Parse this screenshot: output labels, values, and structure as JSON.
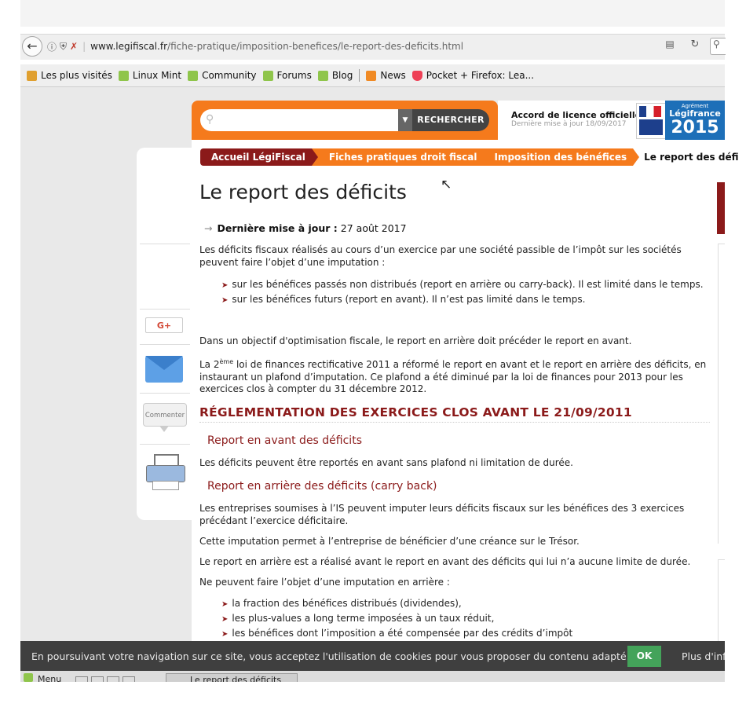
{
  "browser": {
    "url_host": "www.legifiscal.fr",
    "url_path": "/fiche-pratique/imposition-benefices/le-report-des-deficits.html",
    "bookmarks": [
      {
        "label": "Les plus visités",
        "icon": "folder-icon"
      },
      {
        "label": "Linux Mint",
        "icon": "mint-icon"
      },
      {
        "label": "Community",
        "icon": "mint-icon"
      },
      {
        "label": "Forums",
        "icon": "mint-icon"
      },
      {
        "label": "Blog",
        "icon": "mint-icon"
      },
      {
        "label": "News",
        "icon": "rss-icon"
      },
      {
        "label": "Pocket + Firefox: Lea...",
        "icon": "pocket-icon"
      }
    ]
  },
  "header": {
    "search_button": "RECHERCHER",
    "licence_title": "Accord de licence officielle",
    "licence_sub": "Dernière mise à jour 18/09/2017",
    "badge_agrement": "Agrément",
    "badge_name": "Légifrance",
    "badge_year": "2015"
  },
  "breadcrumb": [
    "Accueil LégiFiscal",
    "Fiches pratiques droit fiscal",
    "Imposition des bénéfices",
    "Le report des défi"
  ],
  "article": {
    "title": "Le report des déficits",
    "updated_label": "Dernière mise à jour :",
    "updated_value": "27 août 2017",
    "intro": "Les déficits fiscaux réalisés au cours d’un exercice par une société passible de l’impôt sur les sociétés peuvent faire l’objet d’une  imputation :",
    "intro_bullets": [
      "sur les bénéfices passés non distribués (report en arrière ou carry-back). Il est limité dans le temps.",
      "sur les bénéfices futurs (report en avant). Il n’est pas limité dans le temps."
    ],
    "p_optim": "Dans un objectif d'optimisation fiscale, le report en arrière doit précéder le report en avant.",
    "p_loi_pre": "La 2",
    "p_loi_sup": "ème",
    "p_loi_post": " loi de finances rectificative 2011 a réformé le report en avant et le report en arrière des déficits, en instaurant un plafond d’imputation. Ce plafond a été diminué par la loi de finances pour 2013 pour les exercices clos à compter du 31 décembre 2012.",
    "h_regl": "RÉGLEMENTATION DES EXERCICES CLOS AVANT LE 21/09/2011",
    "sub_avant": "Report en avant des déficits",
    "p_avant": "Les déficits peuvent être reportés en avant sans plafond ni limitation de durée.",
    "sub_arriere": "Report en arrière des déficits (carry back)",
    "p_arriere1": "Les entreprises soumises à l’IS peuvent imputer leurs déficits fiscaux sur les bénéfices des 3 exercices précédant l’exercice déficitaire.",
    "p_arriere2": "Cette imputation permet à l’entreprise de bénéficier d’une créance sur le Trésor.",
    "p_arriere3": "Le report en arrière est a réalisé avant le report en avant des déficits qui lui n’a aucune limite de durée.",
    "p_arriere4": "Ne peuvent faire l’objet d’une imputation en arrière :",
    "arriere_bullets": [
      "la fraction des bénéfices distribués (dividendes),",
      "les plus-values a long terme imposées à un taux réduit,",
      "les bénéfices dont l’imposition a été compensée par des crédits d’impôt"
    ]
  },
  "share": {
    "gplus": "G+",
    "comment": "Commenter"
  },
  "cookie": {
    "text": "En poursuivant votre navigation sur ce site, vous acceptez l'utilisation de cookies pour vous proposer du contenu adapté.",
    "ok": "OK",
    "more": "Plus d'infos"
  },
  "taskbar": {
    "menu": "Menu",
    "task": "Le report des déficits"
  },
  "colors": {
    "orange": "#f57a1c",
    "burgundy": "#8b1a1a",
    "cookie_bg": "#3f3f3f",
    "ok_green": "#44a35a"
  }
}
